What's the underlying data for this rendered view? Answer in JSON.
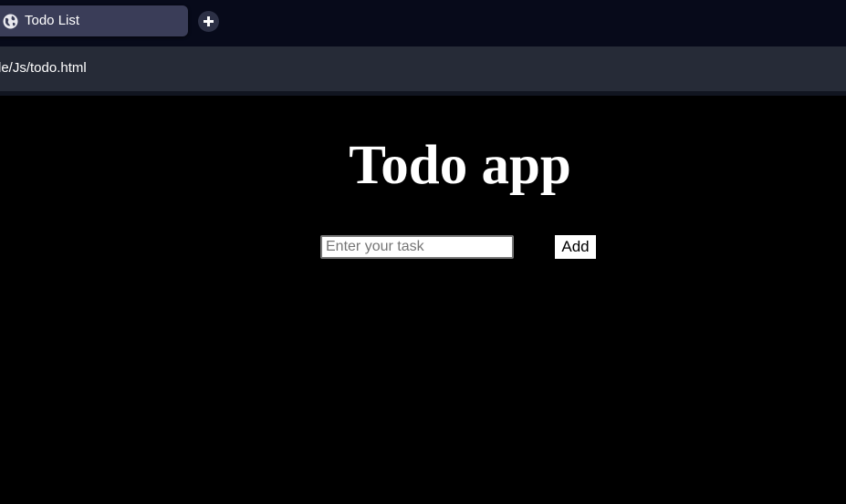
{
  "browser": {
    "tab": {
      "title": "Todo List",
      "icon": "globe-icon"
    },
    "new_tab_icon": "plus-icon",
    "address": {
      "url_text": "le/Js/todo.html"
    }
  },
  "page": {
    "heading": "Todo app",
    "task_input": {
      "placeholder": "Enter your task",
      "value": ""
    },
    "add_button_label": "Add"
  },
  "colors": {
    "page_background": "#000000",
    "tabstrip_background": "#070a1a",
    "active_tab": "#3a3d58",
    "address_bar": "#262b37",
    "text": "#ffffff"
  }
}
